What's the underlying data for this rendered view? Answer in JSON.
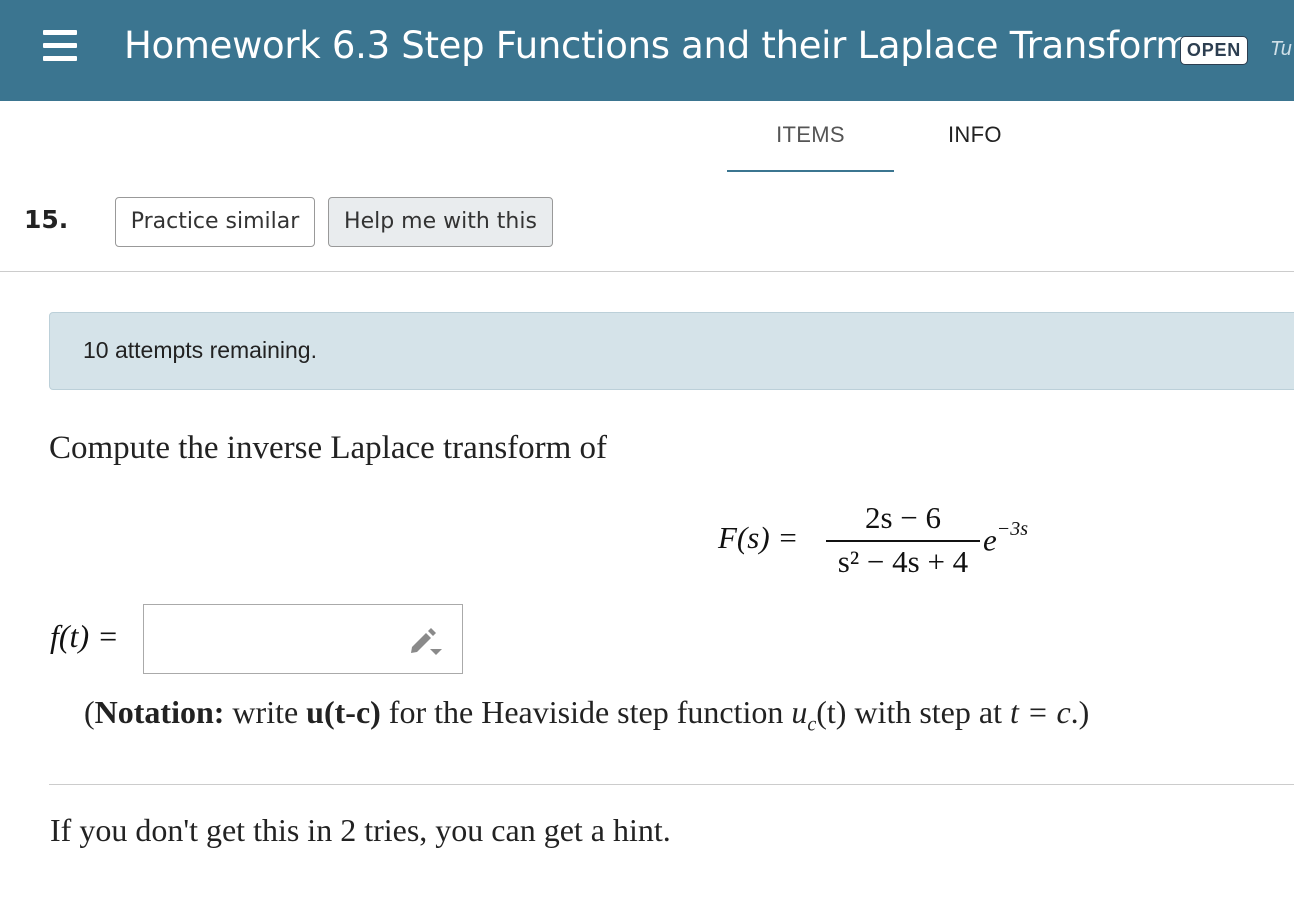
{
  "header": {
    "title": "Homework 6.3 Step Functions and their Laplace Transforms",
    "status_badge": "OPEN",
    "cut_off_text": "Tu",
    "background_color": "#3b7590"
  },
  "tabs": [
    {
      "label": "ITEMS",
      "active": true
    },
    {
      "label": "INFO",
      "active": false
    }
  ],
  "question": {
    "number": "15.",
    "practice_button": "Practice similar",
    "help_button": "Help me with this",
    "attempts_text": "10 attempts remaining.",
    "prompt": "Compute the inverse Laplace transform of",
    "equation": {
      "lhs": "F(s) =",
      "numerator": "2s − 6",
      "denominator": "s² − 4s + 4",
      "factor_base": "e",
      "factor_exponent": "−3s"
    },
    "answer_label": "f(t) =",
    "answer_value": "",
    "notation": {
      "open": "(",
      "bold_word": "Notation:",
      "text1": " write ",
      "bold_code": "u(t-c)",
      "text2": " for the Heaviside step function ",
      "fn": "u",
      "fn_sub": "c",
      "fn_arg": "(t)",
      "text3": " with step at ",
      "cond": "t = c",
      "close": ".)"
    },
    "hint_text": "If you don't get this in 2 tries, you can get a hint."
  },
  "icons": {
    "menu": "menu-icon",
    "edit": "pencil-icon"
  }
}
